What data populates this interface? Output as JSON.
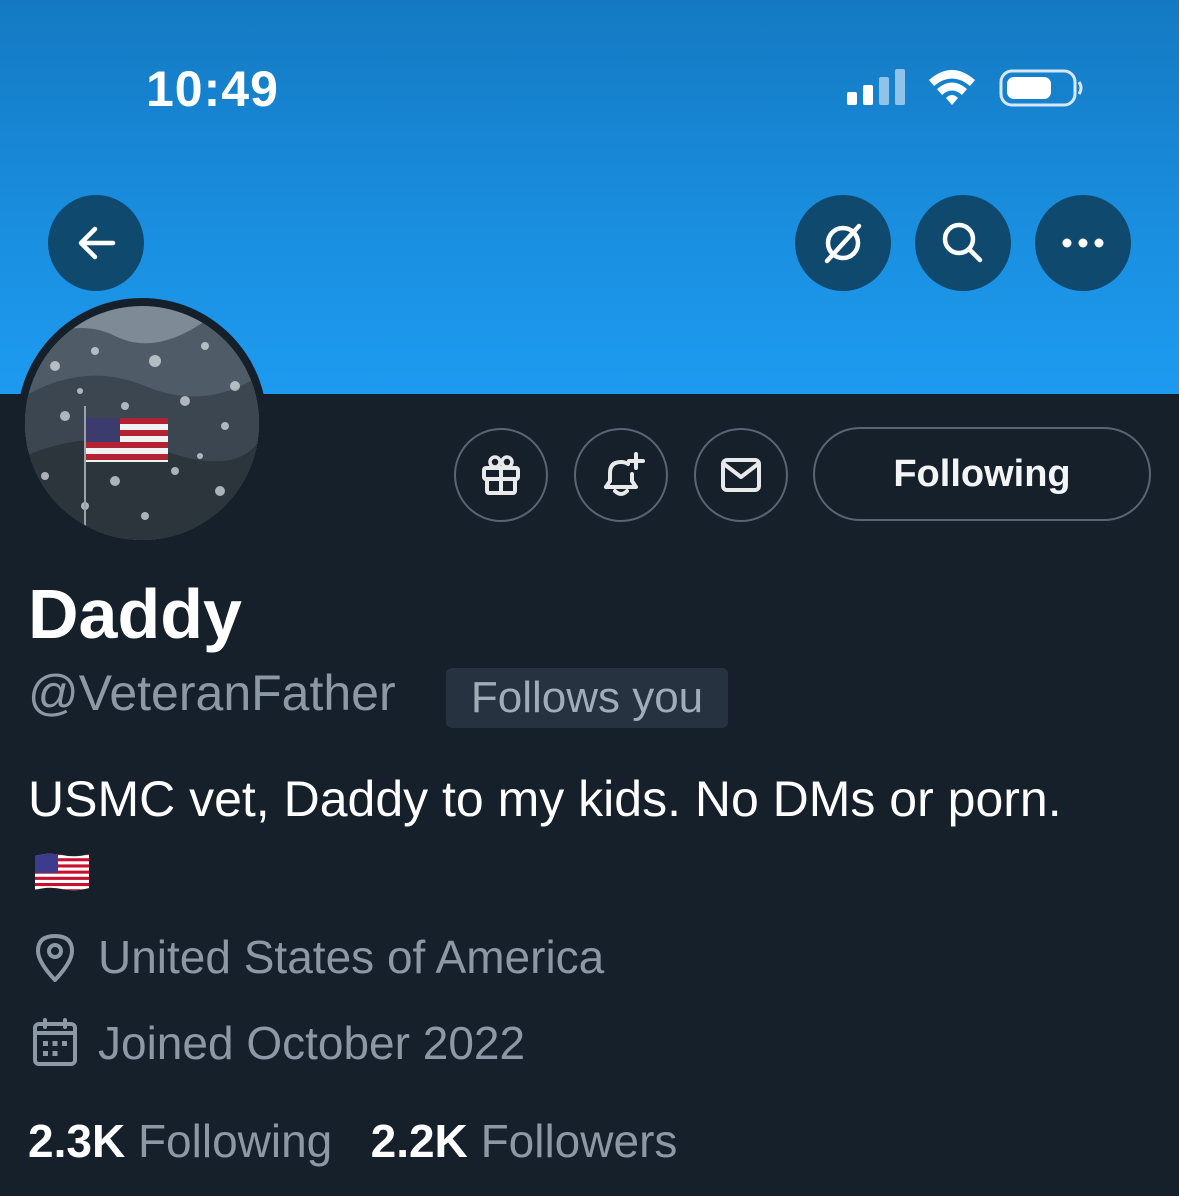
{
  "status_bar": {
    "time": "10:49"
  },
  "nav": {
    "back_icon": "arrow-left-icon",
    "grok_icon": "grok-icon",
    "search_icon": "search-icon",
    "more_icon": "more-icon"
  },
  "profile": {
    "display_name": "Daddy",
    "handle": "@VeteranFather",
    "follows_you": "Follows you",
    "bio": "USMC vet, Daddy to my kids. No DMs or porn.",
    "location": "United States of America",
    "joined": "Joined October 2022",
    "following_count": "2.3K",
    "following_label": "Following",
    "followers_count": "2.2K",
    "followers_label": "Followers"
  },
  "actions": {
    "following_button": "Following",
    "gift_icon": "gift-icon",
    "notify_icon": "bell-plus-icon",
    "message_icon": "mail-icon"
  },
  "colors": {
    "banner": "#1d9bf0",
    "background": "#16202b",
    "secondary_text": "#8c98a4"
  }
}
